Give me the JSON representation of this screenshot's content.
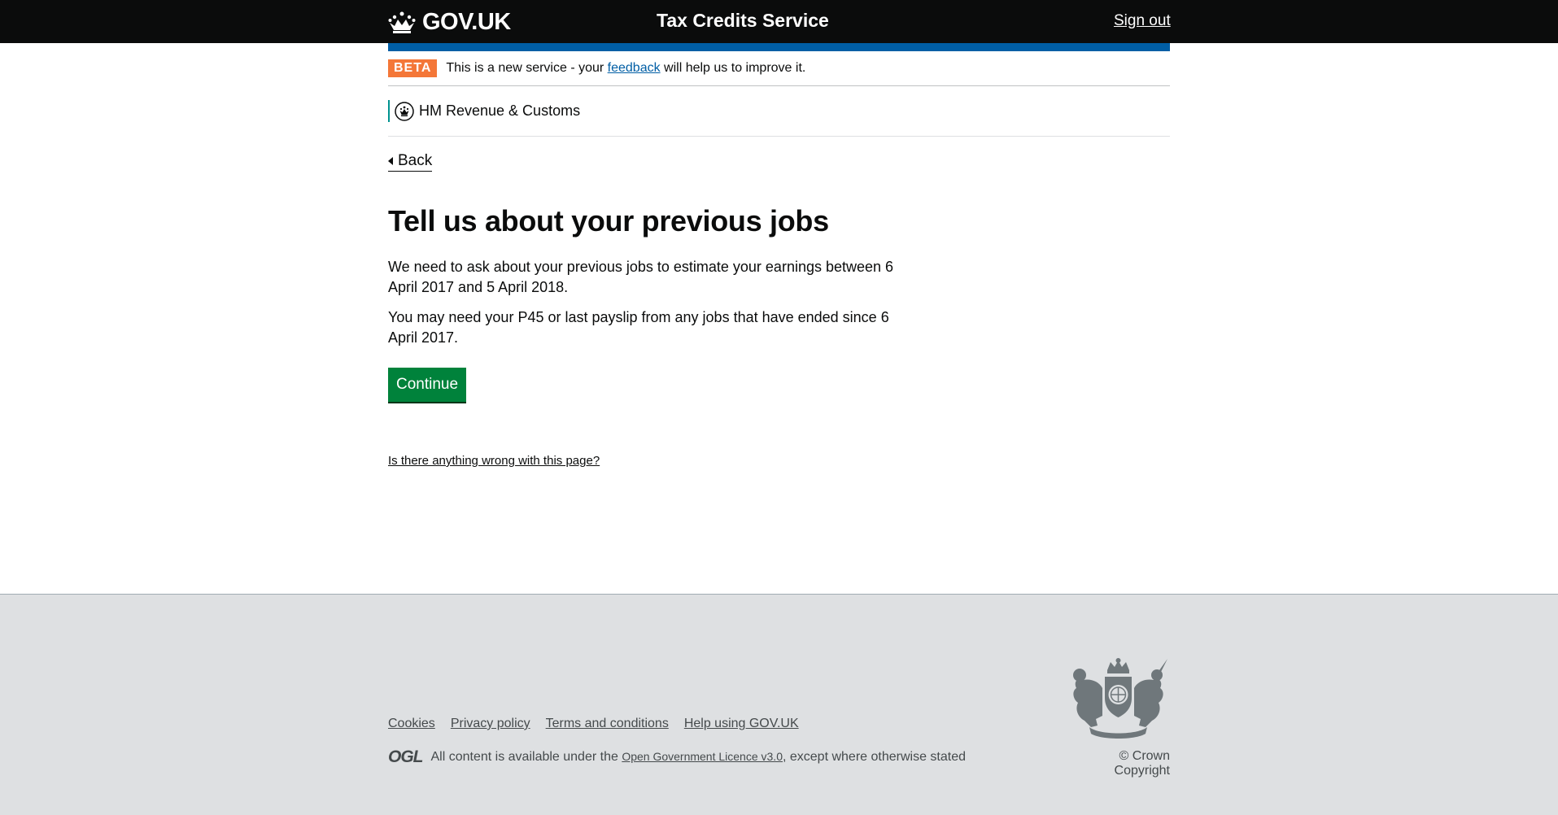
{
  "header": {
    "logo_text": "GOV.UK",
    "service_name": "Tax Credits Service",
    "sign_out": "Sign out"
  },
  "phase_banner": {
    "tag": "BETA",
    "text_before": "This is a new service - your ",
    "link": "feedback",
    "text_after": " will help us to improve it."
  },
  "organisation": {
    "name": "HM Revenue & Customs"
  },
  "back_link": "Back",
  "main": {
    "title": "Tell us about your previous jobs",
    "paragraph_1": "We need to ask about your previous jobs to estimate your earnings between 6 April 2017 and 5 April 2018.",
    "paragraph_2": "You may need your P45 or last payslip from any jobs that have ended since 6 April 2017.",
    "continue_label": "Continue",
    "report_link": "Is there anything wrong with this page?"
  },
  "footer": {
    "links": [
      "Cookies",
      "Privacy policy",
      "Terms and conditions",
      "Help using GOV.UK"
    ],
    "ogl_logo": "OGL",
    "licence_before": "All content is available under the ",
    "licence_link": "Open Government Licence v3.0",
    "licence_after": ", except where otherwise stated",
    "copyright": "© Crown Copyright"
  },
  "colors": {
    "header_bg": "#0b0c0c",
    "blue_bar": "#005ea5",
    "beta_tag": "#f47738",
    "button_green": "#00823b",
    "footer_bg": "#dee0e2"
  }
}
